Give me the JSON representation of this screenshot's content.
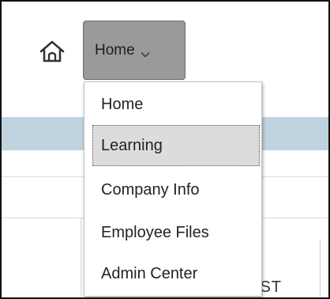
{
  "nav": {
    "home_icon": "home-icon",
    "current_label": "Home",
    "chevron_icon": "chevron-down-icon"
  },
  "menu": {
    "items": [
      {
        "label": "Home"
      },
      {
        "label": "Learning",
        "selected": true
      },
      {
        "label": "Company Info"
      },
      {
        "label": "Employee Files"
      },
      {
        "label": "Admin Center"
      }
    ]
  },
  "background": {
    "peek_text": "CST"
  },
  "colors": {
    "nav_button_bg": "#9a9a9a",
    "selected_item_bg": "#dcdcdc",
    "banner_strip": "#bfd3df"
  }
}
